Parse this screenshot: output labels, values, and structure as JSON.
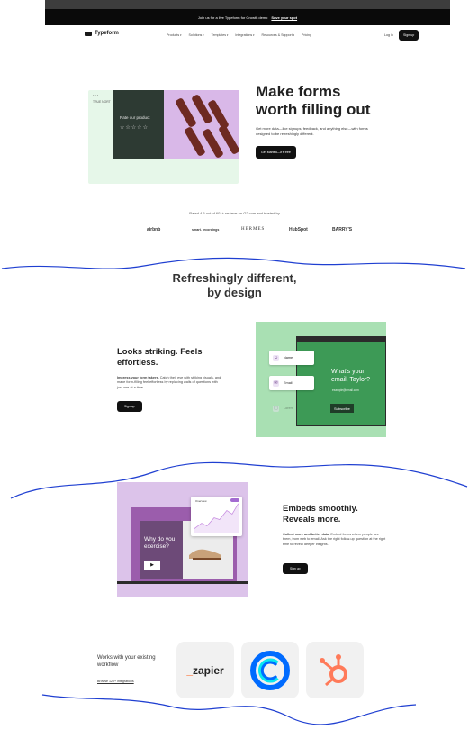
{
  "announcement": {
    "text": "Join us for a live Typeform for Growth demo",
    "link": "Save your spot"
  },
  "nav": {
    "logo": "Typeform",
    "menu": [
      "Products",
      "Solutions",
      "Templates",
      "Integrations",
      "Resources & Support",
      "Pricing"
    ],
    "login": "Log in",
    "signup": "Sign up"
  },
  "hero": {
    "card_dots": "•••",
    "card_label": "TRUE NORT",
    "card_question": "Rate our product",
    "title": "Make forms\nworth filling out",
    "body": "Get more data—like signups, feedback, and anything else—with forms designed to be refreshingly different.",
    "cta": "Get started—it's free"
  },
  "trust": {
    "rated": "Rated 4.5 out of 601+ reviews on G2.com and trusted by",
    "brands": [
      "airbnb",
      "smart. recordings",
      "HERMES",
      "HubSpot",
      "BARRY'S"
    ]
  },
  "section_heading": "Refreshingly different,\nby design",
  "feature1": {
    "title": "Looks striking. Feels\neffortless.",
    "body_bold": "Impress your form takers.",
    "body": "Catch their eye with striking visuals, and make form-filling feel effortless by replacing walls of questions with just one at a time.",
    "cta": "Sign up",
    "chips": [
      "Name",
      "Email",
      "Lorem"
    ],
    "question": "What's your\nemail, Taylor?",
    "sub": "example@email.com",
    "subscribe": "Subscribe"
  },
  "feature2": {
    "title": "Embeds smoothly.\nReveals more.",
    "body_bold": "Collect more and better data.",
    "body": "Embed forms where people see them, from web to email. Ask the right follow-up question at the right time to reveal deeper insights.",
    "cta": "Sign up",
    "question": "Why do you\nexercise?",
    "chart_label": "Overview"
  },
  "integrations": {
    "title": "Works with your existing\nworkflow",
    "link": "Browse 120+ integrations",
    "tiles": [
      "zapier",
      "calendly",
      "hubspot"
    ],
    "zapier_prefix": "_",
    "zapier_text": "zapier"
  },
  "colors": {
    "hero_card": "#e6f7e9",
    "green_panel": "#a9e0b3",
    "purple_panel": "#dcc3ea",
    "annotation": "#1f3fd1",
    "zapier_orange": "#ff4f00",
    "calendly_blue": "#006bff",
    "hubspot_orange": "#ff7a59"
  }
}
